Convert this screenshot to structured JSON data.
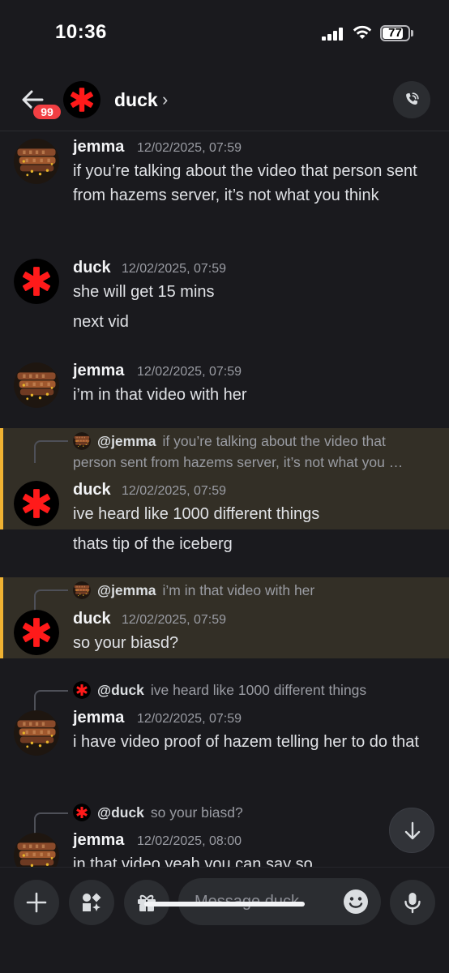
{
  "status_bar": {
    "time": "10:36",
    "battery": "77"
  },
  "header": {
    "unread_badge": "99",
    "channel_name": "duck",
    "chevron": "›"
  },
  "messages": [
    {
      "author": "jemma",
      "timestamp": "12/02/2025, 07:59",
      "lines": [
        "if you’re talking about the video that person sent from hazems server, it’s not what you think"
      ]
    },
    {
      "author": "duck",
      "timestamp": "12/02/2025, 07:59",
      "lines": [
        "she will get 15 mins",
        "next vid"
      ]
    },
    {
      "author": "jemma",
      "timestamp": "12/02/2025, 07:59",
      "lines": [
        "i’m in that video with her"
      ]
    },
    {
      "author": "duck",
      "timestamp": "12/02/2025, 07:59",
      "reply_to": "@jemma",
      "reply_text": "if you’re talking about the video that",
      "reply_text_2": "person sent from hazems server, it’s not what you …",
      "lines": [
        "ive heard like 1000 different things",
        "thats tip of the iceberg"
      ]
    },
    {
      "author": "duck",
      "timestamp": "12/02/2025, 07:59",
      "reply_to": "@jemma",
      "reply_text": "i’m in that video with her",
      "lines": [
        "so your biasd?"
      ]
    },
    {
      "author": "jemma",
      "timestamp": "12/02/2025, 07:59",
      "reply_to": "@duck",
      "reply_text": "ive heard like 1000 different things",
      "lines": [
        "i have video proof of hazem telling her to do that"
      ]
    },
    {
      "author": "jemma",
      "timestamp": "12/02/2025, 08:00",
      "reply_to": "@duck",
      "reply_text": "so your biasd?",
      "lines": [
        "in that video yeah you can say so"
      ]
    }
  ],
  "composer": {
    "placeholder": "Message duck"
  },
  "colors": {
    "background": "#1a1a1e",
    "mention_highlight": "#332f26",
    "mention_bar": "#f0b232",
    "badge": "#f23f43",
    "duck_avatar_bg": "#000000",
    "duck_avatar_star": "#ff1a1a"
  }
}
